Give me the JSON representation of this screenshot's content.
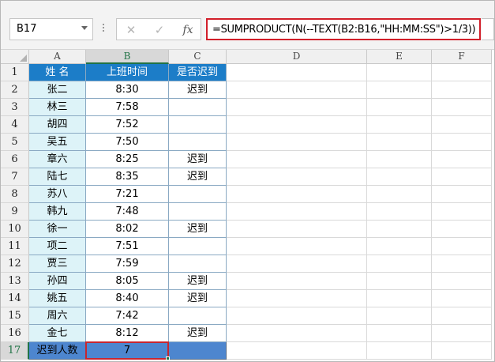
{
  "formula_bar": {
    "name_box": "B17",
    "cancel_icon": "✕",
    "enter_icon": "✓",
    "fx_icon": "fx",
    "formula": "=SUMPRODUCT(N(--TEXT(B2:B16,\"HH:MM:SS\")>1/3))"
  },
  "columns": [
    "A",
    "B",
    "C",
    "D",
    "E",
    "F"
  ],
  "rows": [
    "1",
    "2",
    "3",
    "4",
    "5",
    "6",
    "7",
    "8",
    "9",
    "10",
    "11",
    "12",
    "13",
    "14",
    "15",
    "16",
    "17"
  ],
  "table": {
    "headers": [
      "姓 名",
      "上班时间",
      "是否迟到"
    ],
    "records": [
      [
        "张二",
        "8:30",
        "迟到"
      ],
      [
        "林三",
        "7:58",
        ""
      ],
      [
        "胡四",
        "7:52",
        ""
      ],
      [
        "吴五",
        "7:50",
        ""
      ],
      [
        "章六",
        "8:25",
        "迟到"
      ],
      [
        "陆七",
        "8:35",
        "迟到"
      ],
      [
        "苏八",
        "7:21",
        ""
      ],
      [
        "韩九",
        "7:48",
        ""
      ],
      [
        "徐一",
        "8:02",
        "迟到"
      ],
      [
        "项二",
        "7:51",
        ""
      ],
      [
        "贾三",
        "7:59",
        ""
      ],
      [
        "孙四",
        "8:05",
        "迟到"
      ],
      [
        "姚五",
        "8:40",
        "迟到"
      ],
      [
        "周六",
        "7:42",
        ""
      ],
      [
        "金七",
        "8:12",
        "迟到"
      ]
    ],
    "total": [
      "迟到人数",
      "7",
      ""
    ]
  },
  "selected_cell": "B17",
  "colors": {
    "header_fill": "#1c7dc8",
    "name_fill": "#ddf3f8",
    "total_fill": "#4d86cf",
    "highlight_border": "#d21f2a",
    "excel_green": "#217346"
  }
}
